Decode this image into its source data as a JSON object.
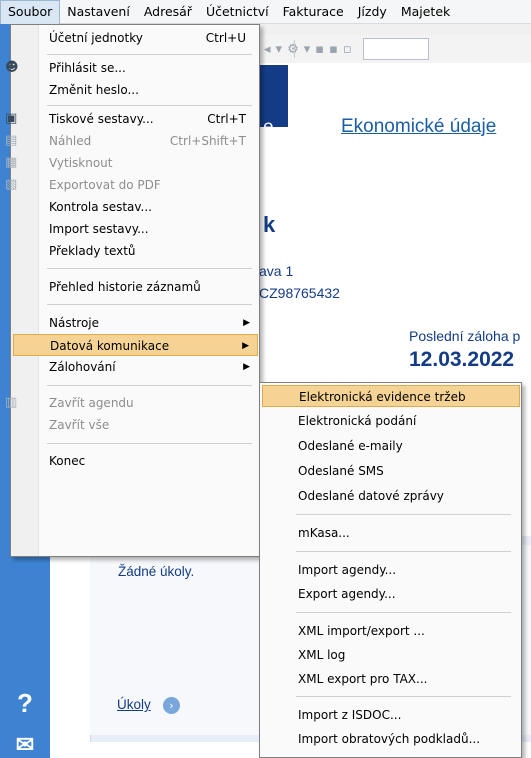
{
  "menubar": [
    "Soubor",
    "Nastavení",
    "Adresář",
    "Účetnictví",
    "Fakturace",
    "Jízdy",
    "Majetek"
  ],
  "colors": {
    "accent": "#3d83d2",
    "header": "#143c86",
    "highlight": "#f5d394"
  },
  "main": {
    "header_text": "e",
    "econ_link": "Ekonomické údaje",
    "company_name": "k",
    "address": "ava 1",
    "vat": "CZ98765432",
    "last_advance_label": "Poslední záloha p",
    "last_advance_date": "12.03.2022",
    "no_tasks": "Žádné úkoly.",
    "tasks_link": "Úkoly"
  },
  "soubor_menu": {
    "items": [
      {
        "label": "Účetní jednotky",
        "shortcut": "Ctrl+U",
        "disabled": false
      },
      {
        "label": "Přihlásit se...",
        "shortcut": "",
        "disabled": false,
        "icon": "user-icon"
      },
      {
        "label": "Změnit heslo...",
        "shortcut": "",
        "disabled": false
      },
      {
        "label": "Tiskové sestavy...",
        "shortcut": "Ctrl+T",
        "disabled": false,
        "icon": "print-icon"
      },
      {
        "label": "Náhled",
        "shortcut": "Ctrl+Shift+T",
        "disabled": true,
        "icon": "preview-icon"
      },
      {
        "label": "Vytisknout",
        "shortcut": "",
        "disabled": true,
        "icon": "printer-icon"
      },
      {
        "label": "Exportovat do PDF",
        "shortcut": "",
        "disabled": true,
        "icon": "pdf-icon"
      },
      {
        "label": "Kontrola sestav...",
        "shortcut": "",
        "disabled": false
      },
      {
        "label": "Import sestavy...",
        "shortcut": "",
        "disabled": false
      },
      {
        "label": "Překlady textů",
        "shortcut": "",
        "disabled": false
      },
      {
        "label": "Přehled historie záznamů",
        "shortcut": "",
        "disabled": false
      },
      {
        "label": "Nástroje",
        "shortcut": "",
        "disabled": false,
        "submenu": true
      },
      {
        "label": "Datová komunikace",
        "shortcut": "",
        "disabled": false,
        "submenu": true,
        "highlight": true
      },
      {
        "label": "Zálohování",
        "shortcut": "",
        "disabled": false,
        "submenu": true
      },
      {
        "label": "Zavřít agendu",
        "shortcut": "",
        "disabled": true,
        "icon": "close-agenda-icon"
      },
      {
        "label": "Zavřít vše",
        "shortcut": "",
        "disabled": true
      },
      {
        "label": "Konec",
        "shortcut": "",
        "disabled": false
      }
    ]
  },
  "datova_menu": {
    "items": [
      {
        "label": "Elektronická evidence tržeb",
        "highlight": true
      },
      {
        "label": "Elektronická podání"
      },
      {
        "label": "Odeslané e-maily"
      },
      {
        "label": "Odeslané SMS"
      },
      {
        "label": "Odeslané datové zprávy"
      },
      {
        "label": "mKasa..."
      },
      {
        "label": "Import agendy..."
      },
      {
        "label": "Export agendy..."
      },
      {
        "label": "XML import/export ..."
      },
      {
        "label": "XML log"
      },
      {
        "label": "XML export pro TAX..."
      },
      {
        "label": "Import z ISDOC..."
      },
      {
        "label": "Import obratových podkladů..."
      }
    ]
  },
  "icons": {
    "help": "?",
    "mail": "✉",
    "arrow": "›"
  }
}
